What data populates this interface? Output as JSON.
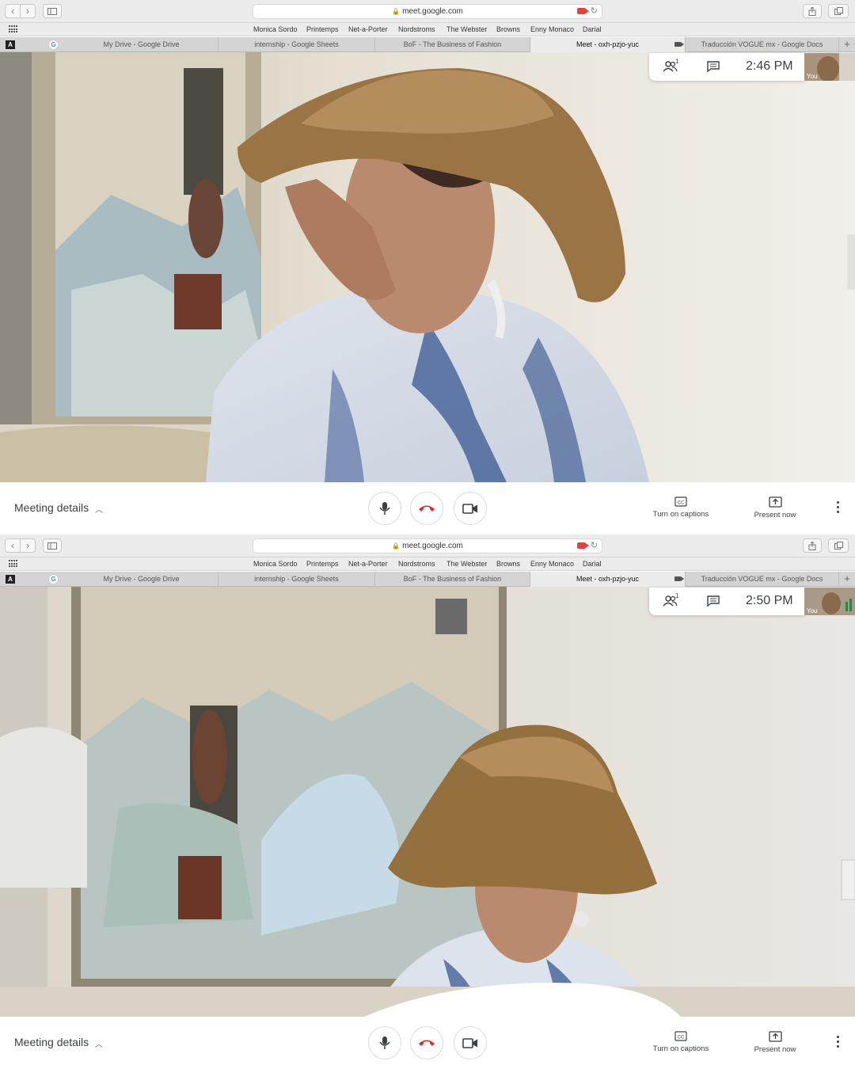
{
  "browser": {
    "url": "meet.google.com",
    "bookmarks": [
      "Monica Sordo",
      "Printemps",
      "Net-a-Porter",
      "Nordstroms",
      "The Webster",
      "Browns",
      "Enny Monaco",
      "Darial"
    ],
    "tabs": [
      {
        "label": "My Drive - Google Drive"
      },
      {
        "label": "internship - Google Sheets"
      },
      {
        "label": "BoF - The Business of Fashion"
      },
      {
        "label": "Meet - oxh-pzjo-yuc"
      },
      {
        "label": "Traducción VOGUE mx - Google Docs"
      }
    ],
    "favicon_a": "A",
    "favicon_g": "G",
    "new_tab": "+"
  },
  "meet": {
    "people_count": "1",
    "self_label": "You",
    "meeting_details": "Meeting details",
    "captions_label": "Turn on captions",
    "present_label": "Present now",
    "cc_text": "CC"
  },
  "screens": [
    {
      "time": "2:46 PM"
    },
    {
      "time": "2:50 PM"
    }
  ],
  "colors": {
    "hangup": "#d93025",
    "recording": "#e3443a",
    "ui_text": "#3c4043"
  }
}
